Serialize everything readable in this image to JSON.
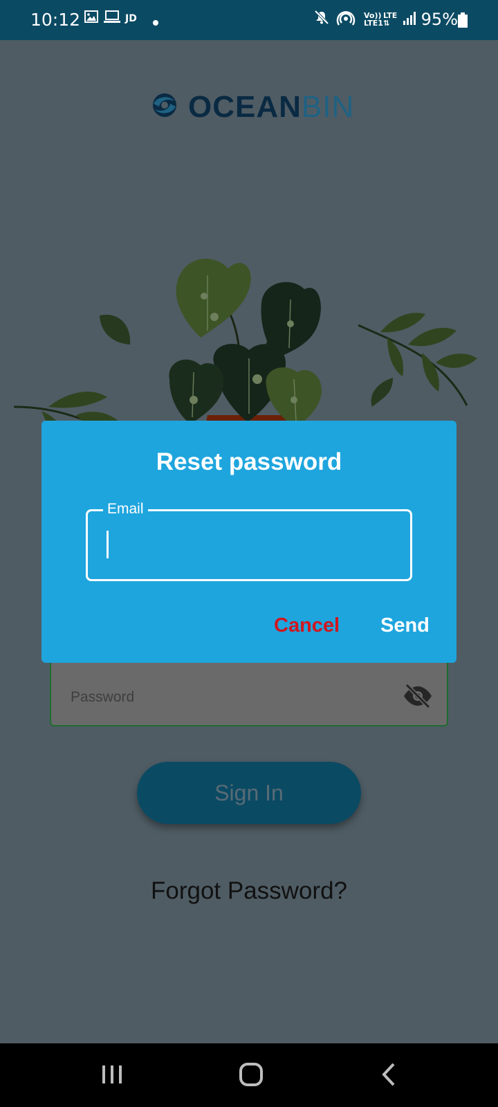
{
  "status_bar": {
    "time": "10:12",
    "icons": [
      "image-icon",
      "laptop-icon",
      "jio-icon",
      "dot-icon",
      "mute-icon",
      "hotspot-icon",
      "volte-icon",
      "lte-icon",
      "signal-icon",
      "battery-icon"
    ],
    "jd_text": "JD",
    "volte_line1": "Vo))",
    "volte_line2": "LTE1",
    "lte_text": "LTE",
    "battery": "95%"
  },
  "app": {
    "logo_ocean": "OCEAN",
    "logo_bin": "BIN"
  },
  "login": {
    "password_placeholder": "Password",
    "sign_in_label": "Sign In",
    "forgot_password": "Forgot Password?"
  },
  "dialog": {
    "title": "Reset password",
    "email_label": "Email",
    "email_value": "",
    "cancel_label": "Cancel",
    "send_label": "Send"
  },
  "colors": {
    "status_bar": "#0b4a63",
    "dialog_bg": "#1ea5de",
    "cancel": "#d0161f",
    "button_bg": "#0b4a63"
  }
}
